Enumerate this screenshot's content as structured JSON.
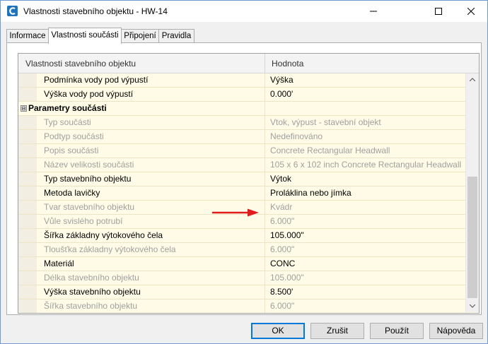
{
  "window": {
    "title": "Vlastnosti stavebního objektu - HW-14"
  },
  "tabs": [
    {
      "label": "Informace",
      "active": false
    },
    {
      "label": "Vlastnosti součásti",
      "active": true
    },
    {
      "label": "Připojení",
      "active": false
    },
    {
      "label": "Pravidla",
      "active": false
    }
  ],
  "grid": {
    "header": {
      "property": "Vlastnosti stavebního objektu",
      "value": "Hodnota"
    },
    "rows": [
      {
        "property": "Podmínka vody pod výpustí",
        "value": "Výška",
        "disabled": false
      },
      {
        "property": "Výška vody pod výpustí",
        "value": "0.000'",
        "disabled": false
      },
      {
        "property": "Parametry součásti",
        "value": "",
        "group": true,
        "expander": "⊟"
      },
      {
        "property": "Typ součásti",
        "value": "Vtok, výpust - stavební objekt",
        "disabled": true
      },
      {
        "property": "Podtyp součásti",
        "value": "Nedefinováno",
        "disabled": true
      },
      {
        "property": "Popis součásti",
        "value": "Concrete Rectangular Headwall",
        "disabled": true
      },
      {
        "property": "Název velikosti součásti",
        "value": "105 x 6 x 102 inch Concrete Rectangular Headwall",
        "disabled": true
      },
      {
        "property": "Typ stavebního objektu",
        "value": "Výtok",
        "disabled": false
      },
      {
        "property": "Metoda lavičky",
        "value": "Proláklina nebo jímka",
        "disabled": false
      },
      {
        "property": "Tvar stavebního objektu",
        "value": "Kvádr",
        "disabled": true
      },
      {
        "property": "Vůle svislého potrubí",
        "value": "6.000\"",
        "disabled": true
      },
      {
        "property": "Šířka základny výtokového čela",
        "value": "105.000\"",
        "disabled": false
      },
      {
        "property": "Tloušťka základny výtokového čela",
        "value": "6.000\"",
        "disabled": true
      },
      {
        "property": "Materiál",
        "value": "CONC",
        "disabled": false
      },
      {
        "property": "Délka stavebního objektu",
        "value": "105.000\"",
        "disabled": true
      },
      {
        "property": "Výška stavebního objektu",
        "value": "8.500'",
        "disabled": false
      },
      {
        "property": "Šířka stavebního objektu",
        "value": "6.000\"",
        "disabled": true
      }
    ]
  },
  "buttons": {
    "ok": "OK",
    "cancel": "Zrušit",
    "apply": "Použít",
    "help": "Nápověda"
  },
  "colors": {
    "grid_background": "#fffbe6",
    "disabled_text": "#a0a0a0",
    "annotation_arrow": "#e01b1b",
    "default_button_border": "#0078d7"
  },
  "icons": {
    "app": "civil3d-icon",
    "minimize": "minimize-icon",
    "maximize": "maximize-icon",
    "close": "close-icon"
  }
}
